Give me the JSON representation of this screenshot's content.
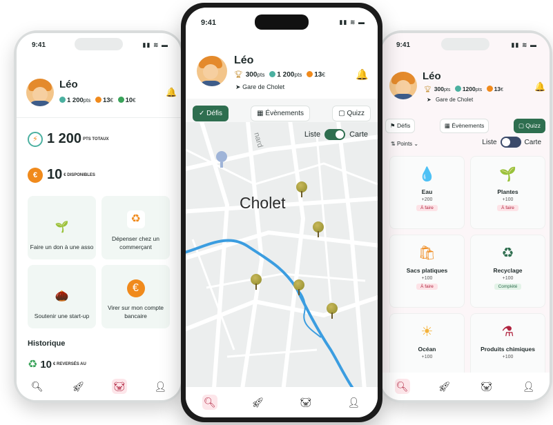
{
  "status": {
    "time": "9:41"
  },
  "user": {
    "name": "Léo",
    "points": "1 200",
    "euros": "13",
    "cycles": "10"
  },
  "left": {
    "stats": {
      "points": "1 200",
      "points_unit": "pts",
      "euros": "13",
      "euro_unit": "€",
      "cycles": "10",
      "cycle_unit": "€"
    },
    "total_value": "1 200",
    "total_label": "PTS TOTAUX",
    "available_value": "10",
    "available_label": "€ DISPONIBLES",
    "tiles": [
      {
        "label": "Faire un don à une asso",
        "icon": "sprout-icon"
      },
      {
        "label": "Dépenser chez un commerçant",
        "icon": "shopping-bag-icon"
      },
      {
        "label": "Soutenir une start-up",
        "icon": "seedling-growth-icon"
      },
      {
        "label": "Virer sur mon compte bancaire",
        "icon": "euro-coin-icon"
      }
    ],
    "history_title": "Historique",
    "history_value": "10",
    "history_label": "€ REVERSÉS AU"
  },
  "center": {
    "stats": {
      "trophies": "300",
      "trophy_unit": "pts",
      "points": "1 200",
      "points_unit": "pts",
      "euros": "13",
      "euro_unit": "€"
    },
    "location": "Gare de Cholet",
    "chips": [
      "Défis",
      "Évènements",
      "Quizz"
    ],
    "active_chip": "Défis",
    "toggle_left": "Liste",
    "toggle_right": "Carte",
    "map_city": "Cholet",
    "map_street": "nard"
  },
  "right": {
    "stats": {
      "trophies": "300",
      "trophy_unit": "pts",
      "points": "1200",
      "points_unit": "pts",
      "euros": "13",
      "euro_unit": "€"
    },
    "location": "Gare de Cholet",
    "chips": [
      "Défis",
      "Évènements",
      "Quizz"
    ],
    "active_chip": "Quizz",
    "filter": "Points",
    "toggle_left": "Liste",
    "toggle_right": "Carte",
    "tiles": [
      {
        "name": "Eau",
        "points": "+200",
        "status": "À faire",
        "icon": "water-drop-icon"
      },
      {
        "name": "Plantes",
        "points": "+100",
        "status": "À faire",
        "icon": "plant-box-icon"
      },
      {
        "name": "Sacs platiques",
        "points": "+100",
        "status": "À faire",
        "icon": "plastic-bag-icon"
      },
      {
        "name": "Recyclage",
        "points": "+100",
        "status": "Complété",
        "icon": "recycle-icon"
      },
      {
        "name": "Océan",
        "points": "+100",
        "status": "",
        "icon": "ocean-icon"
      },
      {
        "name": "Produits chimiques",
        "points": "+100",
        "status": "",
        "icon": "chemical-icon"
      }
    ]
  },
  "colors": {
    "brand_green": "#2e6e4f",
    "accent_red": "#b0243f",
    "coin_orange": "#f08a1c",
    "river_blue": "#3b9de0"
  }
}
